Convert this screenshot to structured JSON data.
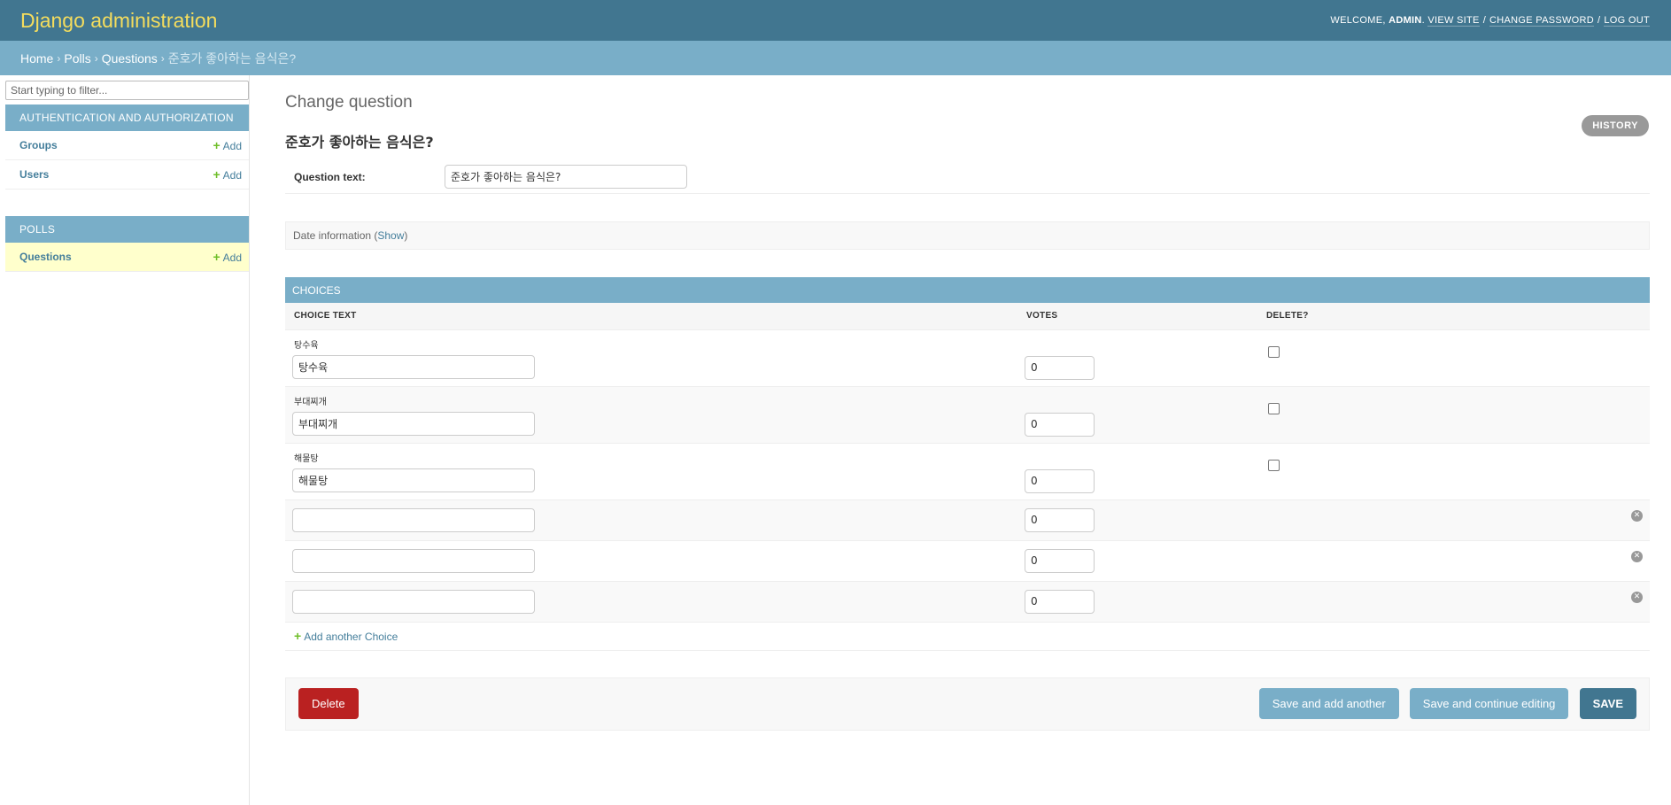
{
  "header": {
    "brand": "Django administration",
    "welcome": "WELCOME,",
    "user": "ADMIN",
    "view_site": "VIEW SITE",
    "change_password": "CHANGE PASSWORD",
    "log_out": "LOG OUT"
  },
  "breadcrumbs": {
    "home": "Home",
    "app": "Polls",
    "model": "Questions",
    "current": "준호가 좋아하는 음식은?"
  },
  "sidebar": {
    "filter_placeholder": "Start typing to filter...",
    "add_label": "Add",
    "modules": [
      {
        "caption": "AUTHENTICATION AND AUTHORIZATION",
        "models": [
          "Groups",
          "Users"
        ]
      },
      {
        "caption": "POLLS",
        "models": [
          "Questions"
        ]
      }
    ]
  },
  "content": {
    "page_title": "Change question",
    "object_title": "준호가 좋아하는 음식은?",
    "history": "HISTORY",
    "question_label": "Question text:",
    "question_value": "준호가 좋아하는 음식은?",
    "date_info": "Date information (",
    "date_show": "Show",
    "date_close": ")"
  },
  "inline": {
    "caption": "CHOICES",
    "headers": [
      "CHOICE TEXT",
      "VOTES",
      "DELETE?"
    ],
    "existing": [
      {
        "original": "탕수육",
        "text": "탕수육",
        "votes": "0"
      },
      {
        "original": "부대찌개",
        "text": "부대찌개",
        "votes": "0"
      },
      {
        "original": "해물탕",
        "text": "해물탕",
        "votes": "0"
      }
    ],
    "extra": [
      {
        "text": "",
        "votes": "0"
      },
      {
        "text": "",
        "votes": "0"
      },
      {
        "text": "",
        "votes": "0"
      }
    ],
    "add_another": "Add another Choice"
  },
  "submit": {
    "delete": "Delete",
    "save_add_another": "Save and add another",
    "save_continue": "Save and continue editing",
    "save": "SAVE"
  },
  "colors": {
    "header_bg": "#417690",
    "brand": "#f5dd5d",
    "breadcrumb_bg": "#79aec8",
    "link": "#447e9b",
    "add_green": "#70bf2b",
    "delete_red": "#ba2121",
    "current_row": "#ffffcc"
  }
}
